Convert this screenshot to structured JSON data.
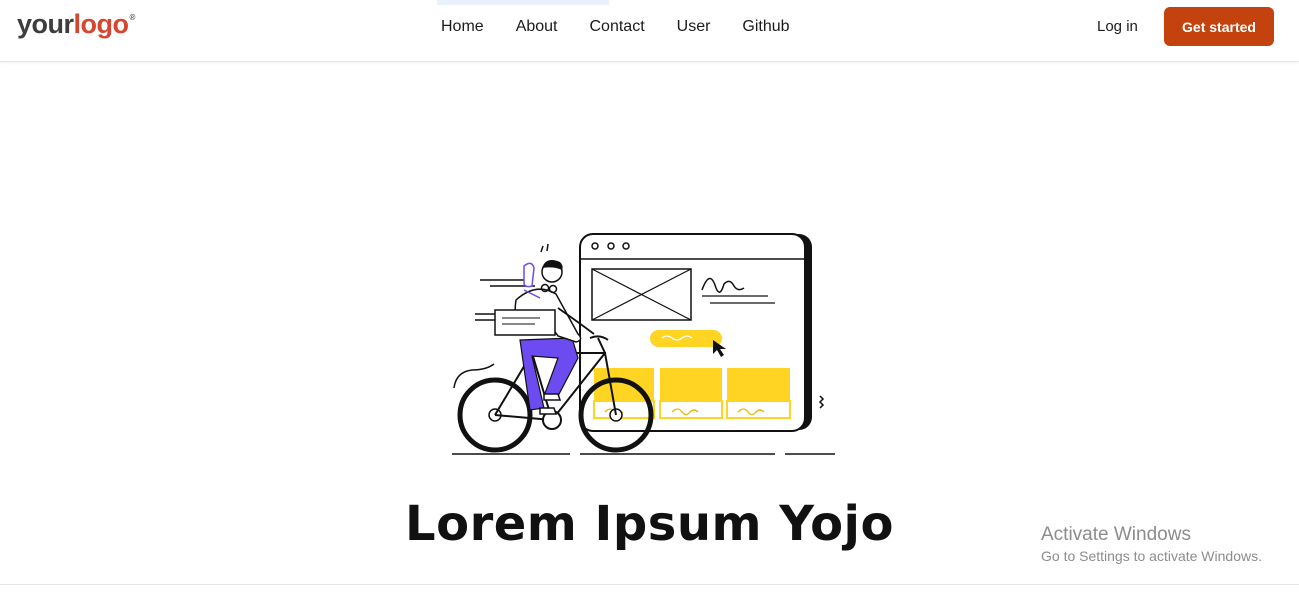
{
  "brand": {
    "logo_part1": "your",
    "logo_part2": "logo",
    "logo_mark": "®"
  },
  "nav": {
    "items": [
      {
        "label": "Home"
      },
      {
        "label": "About"
      },
      {
        "label": "Contact"
      },
      {
        "label": "User"
      },
      {
        "label": "Github"
      }
    ]
  },
  "auth": {
    "login_label": "Log in",
    "cta_label": "Get started"
  },
  "hero": {
    "title": "Lorem Ipsum Yojo",
    "illustration_icon": "cyclist-delivery-illustration"
  },
  "os_watermark": {
    "line1": "Activate Windows",
    "line2": "Go to Settings to activate Windows."
  },
  "colors": {
    "brand_accent": "#d6452f",
    "cta": "#c4420e",
    "illustration_yellow": "#ffd422",
    "illustration_purple": "#6c4cf1"
  }
}
